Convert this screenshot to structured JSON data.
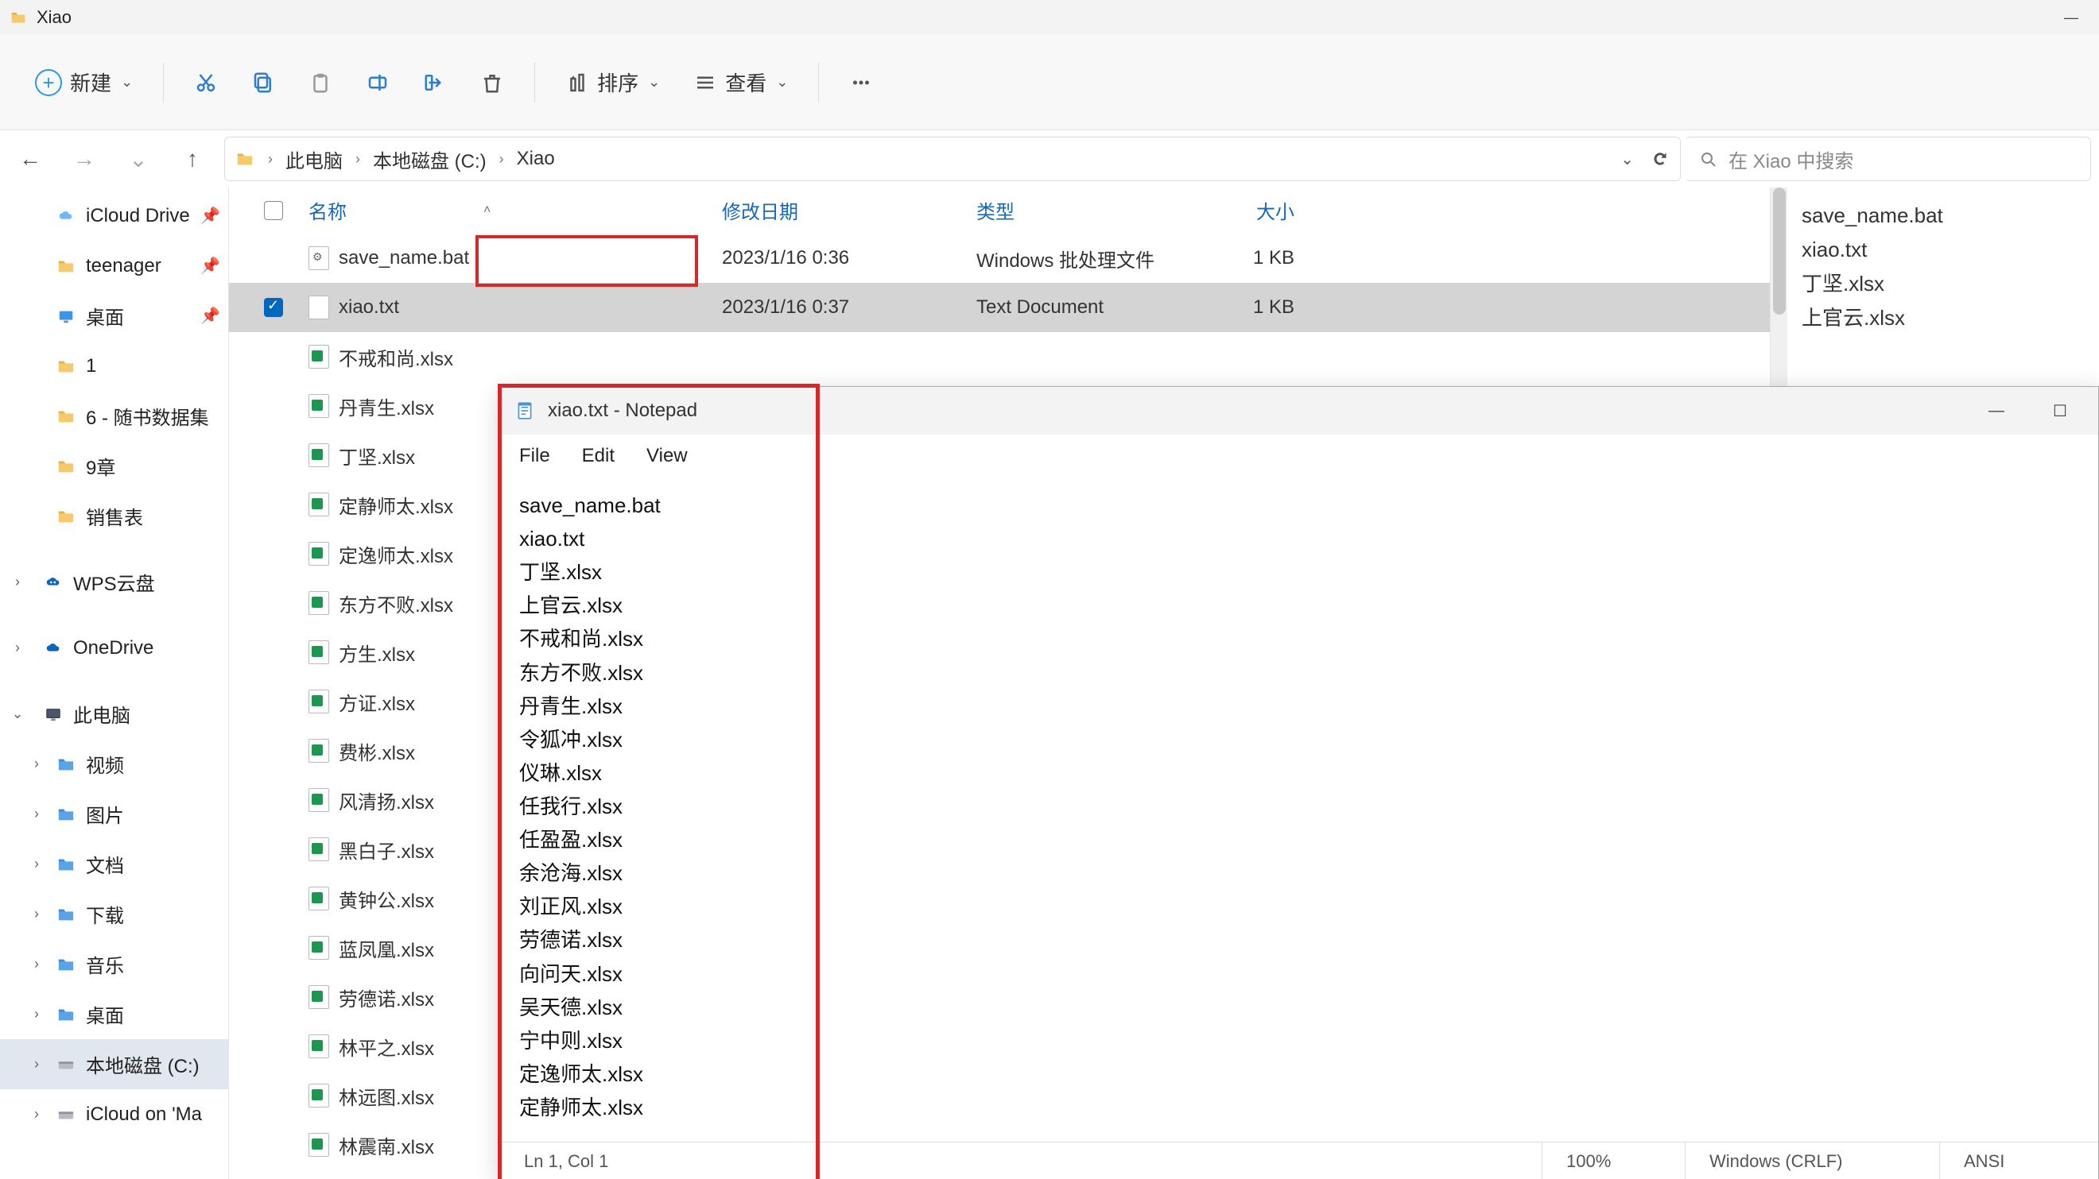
{
  "window": {
    "title": "Xiao"
  },
  "toolbar": {
    "new": "新建",
    "sort": "排序",
    "view": "查看"
  },
  "breadcrumb": {
    "parts": [
      "此电脑",
      "本地磁盘 (C:)",
      "Xiao"
    ]
  },
  "search": {
    "placeholder": "在 Xiao 中搜索"
  },
  "sidebar": {
    "items": [
      {
        "label": "iCloud Drive",
        "icon": "cloud",
        "pinned": true,
        "indent": 1
      },
      {
        "label": "teenager",
        "icon": "folder",
        "pinned": true,
        "indent": 1
      },
      {
        "label": "桌面",
        "icon": "monitor",
        "pinned": true,
        "indent": 1
      },
      {
        "label": "1",
        "icon": "folder",
        "indent": 1
      },
      {
        "label": "6 - 随书数据集",
        "icon": "folder",
        "indent": 1
      },
      {
        "label": "9章",
        "icon": "folder",
        "indent": 1
      },
      {
        "label": "销售表",
        "icon": "folder",
        "indent": 1
      },
      {
        "label": "WPS云盘",
        "icon": "wps",
        "chevron": true,
        "indent": 0,
        "gapTop": true
      },
      {
        "label": "OneDrive",
        "icon": "onedrive",
        "chevron": true,
        "indent": 0,
        "gapTop": true
      },
      {
        "label": "此电脑",
        "icon": "pc",
        "chevron": true,
        "expanded": true,
        "indent": 0,
        "gapTop": true
      },
      {
        "label": "视频",
        "icon": "folder-blue",
        "chevron": true,
        "indent": 1
      },
      {
        "label": "图片",
        "icon": "folder-blue",
        "chevron": true,
        "indent": 1
      },
      {
        "label": "文档",
        "icon": "folder-blue",
        "chevron": true,
        "indent": 1
      },
      {
        "label": "下载",
        "icon": "folder-blue",
        "chevron": true,
        "indent": 1
      },
      {
        "label": "音乐",
        "icon": "folder-blue",
        "chevron": true,
        "indent": 1
      },
      {
        "label": "桌面",
        "icon": "folder-blue",
        "chevron": true,
        "indent": 1
      },
      {
        "label": "本地磁盘 (C:)",
        "icon": "drive",
        "chevron": true,
        "selected": true,
        "indent": 1
      },
      {
        "label": "iCloud on 'Ma",
        "icon": "drive-net",
        "chevron": true,
        "indent": 1
      }
    ]
  },
  "columns": {
    "name": "名称",
    "date": "修改日期",
    "type": "类型",
    "size": "大小"
  },
  "files": [
    {
      "name": "save_name.bat",
      "date": "2023/1/16 0:36",
      "type": "Windows 批处理文件",
      "size": "1 KB",
      "icon": "bat"
    },
    {
      "name": "xiao.txt",
      "date": "2023/1/16 0:37",
      "type": "Text Document",
      "size": "1 KB",
      "icon": "txt",
      "selected": true
    },
    {
      "name": "不戒和尚.xlsx",
      "icon": "xlsx"
    },
    {
      "name": "丹青生.xlsx",
      "icon": "xlsx"
    },
    {
      "name": "丁坚.xlsx",
      "icon": "xlsx"
    },
    {
      "name": "定静师太.xlsx",
      "icon": "xlsx"
    },
    {
      "name": "定逸师太.xlsx",
      "icon": "xlsx"
    },
    {
      "name": "东方不败.xlsx",
      "icon": "xlsx"
    },
    {
      "name": "方生.xlsx",
      "icon": "xlsx"
    },
    {
      "name": "方证.xlsx",
      "icon": "xlsx"
    },
    {
      "name": "费彬.xlsx",
      "icon": "xlsx"
    },
    {
      "name": "风清扬.xlsx",
      "icon": "xlsx"
    },
    {
      "name": "黑白子.xlsx",
      "icon": "xlsx"
    },
    {
      "name": "黄钟公.xlsx",
      "icon": "xlsx"
    },
    {
      "name": "蓝凤凰.xlsx",
      "icon": "xlsx"
    },
    {
      "name": "劳德诺.xlsx",
      "icon": "xlsx"
    },
    {
      "name": "林平之.xlsx",
      "icon": "xlsx"
    },
    {
      "name": "林远图.xlsx",
      "icon": "xlsx"
    },
    {
      "name": "林震南.xlsx",
      "icon": "xlsx"
    }
  ],
  "details": {
    "lines": [
      "save_name.bat",
      "xiao.txt",
      "丁坚.xlsx",
      "上官云.xlsx"
    ]
  },
  "notepad": {
    "title": "xiao.txt - Notepad",
    "menu": {
      "file": "File",
      "edit": "Edit",
      "view": "View"
    },
    "content": "save_name.bat\nxiao.txt\n丁坚.xlsx\n上官云.xlsx\n不戒和尚.xlsx\n东方不败.xlsx\n丹青生.xlsx\n令狐冲.xlsx\n仪琳.xlsx\n任我行.xlsx\n任盈盈.xlsx\n余沧海.xlsx\n刘正风.xlsx\n劳德诺.xlsx\n向问天.xlsx\n吴天德.xlsx\n宁中则.xlsx\n定逸师太.xlsx\n定静师太.xlsx",
    "status": {
      "pos": "Ln 1, Col 1",
      "zoom": "100%",
      "eol": "Windows (CRLF)",
      "enc": "ANSI"
    }
  }
}
